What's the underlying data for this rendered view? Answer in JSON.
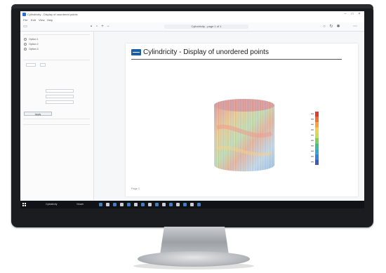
{
  "window": {
    "title": "Cylindricity - Display of unordered points",
    "menu": [
      "File",
      "Edit",
      "View",
      "Help"
    ]
  },
  "toolbar": {
    "address": "Cylindricity - page 1 of 1"
  },
  "sidebar": {
    "options": [
      "Option 1",
      "Option 2",
      "Option 3"
    ],
    "button_label": "Apply"
  },
  "page": {
    "title": "Cylindricity - Display of unordered points",
    "footer": "Page 1"
  },
  "legend": {
    "colors": [
      "#e43b2c",
      "#f0712b",
      "#f5a33a",
      "#f2d04a",
      "#c6dd55",
      "#7bcf5a",
      "#3fbf8f",
      "#33a9c9",
      "#3a83d4",
      "#3a5bbd"
    ]
  },
  "taskbar": {
    "items": [
      "Cylindricity",
      "Viewer"
    ]
  }
}
